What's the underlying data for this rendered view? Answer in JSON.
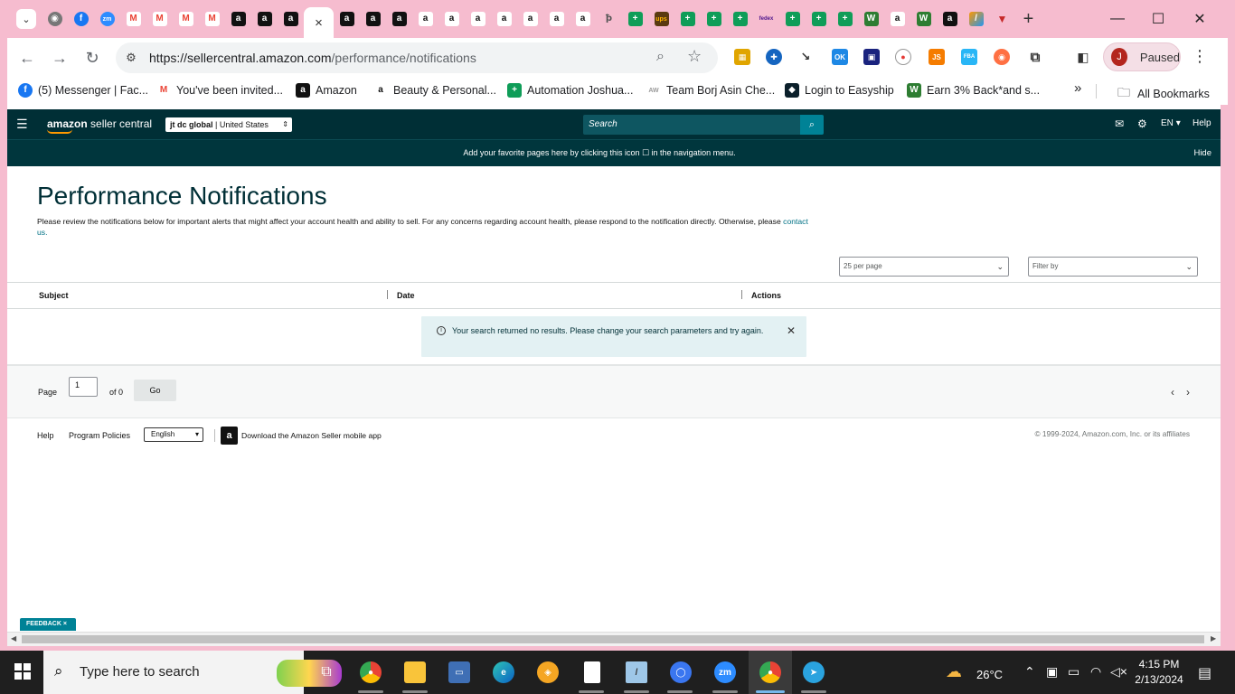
{
  "browser": {
    "active_tab_close": "×",
    "newtab": "+",
    "window_controls": {
      "minimize": "—",
      "maximize": "☐",
      "close": "✕"
    },
    "url_host": "https://sellercentral.amazon.com",
    "url_path": "/performance/notifications",
    "profile_initial": "J",
    "profile_status": "Paused",
    "bookmarks": [
      {
        "label": "(5) Messenger | Fac...",
        "icon": "facebook-icon",
        "color": "#1877f2"
      },
      {
        "label": "You've been invited...",
        "icon": "gmail-icon",
        "color": "#ea4335"
      },
      {
        "label": "Amazon",
        "icon": "amazon-icon",
        "color": "#111111"
      },
      {
        "label": "Beauty & Personal...",
        "icon": "amazon-icon",
        "color": "#ffffff"
      },
      {
        "label": "Automation Joshua...",
        "icon": "sheets-icon",
        "color": "#0f9d58"
      },
      {
        "label": "Team Borj Asin Che...",
        "icon": "team-icon",
        "color": "#999999"
      },
      {
        "label": "Login to Easyship",
        "icon": "easyship-icon",
        "color": "#0b1f2a"
      },
      {
        "label": "Earn 3% Back*and s...",
        "icon": "earn-icon",
        "color": "#2e7d32"
      }
    ],
    "bookmarks_overflow": "»",
    "all_bookmarks": "All Bookmarks"
  },
  "header": {
    "brand_bold": "amazon",
    "brand_rest": " seller central",
    "account_name": "jt dc global",
    "account_sep": " | ",
    "account_region": "United States",
    "search_placeholder": "Search",
    "language": "EN",
    "help": "Help"
  },
  "favorites_banner": {
    "text": "Add your favorite pages here by clicking this icon ☐ in the navigation menu.",
    "hide": "Hide"
  },
  "main": {
    "title": "Performance Notifications",
    "description": "Please review the notifications below for important alerts that might affect your account health and ability to sell. For any concerns regarding account health, please respond to the notification directly. Otherwise, please",
    "contact_link": "contact us.",
    "per_page": "25 per page",
    "filter_placeholder": "Filter by",
    "columns": [
      "Subject",
      "Date",
      "Actions"
    ],
    "no_results": "Your search returned no results. Please change your search parameters and try again.",
    "pager": {
      "page_label": "Page",
      "page_value": "1",
      "of_label": "of 0",
      "go": "Go"
    }
  },
  "footer": {
    "help": "Help",
    "program_policies": "Program Policies",
    "language": "English",
    "app_text": "Download the Amazon Seller mobile app",
    "copyright": "© 1999-2024, Amazon.com, Inc. or its affiliates",
    "feedback": "FEEDBACK ×"
  },
  "taskbar": {
    "search_placeholder": "Type here to search",
    "temperature": "26°C",
    "time": "4:15 PM",
    "date": "2/13/2024"
  },
  "colors": {
    "chrome_frame": "#f6bccf",
    "asc_header": "#002f36",
    "asc_teal": "#008296",
    "link": "#007185",
    "info_bg": "#e3f1f3"
  }
}
